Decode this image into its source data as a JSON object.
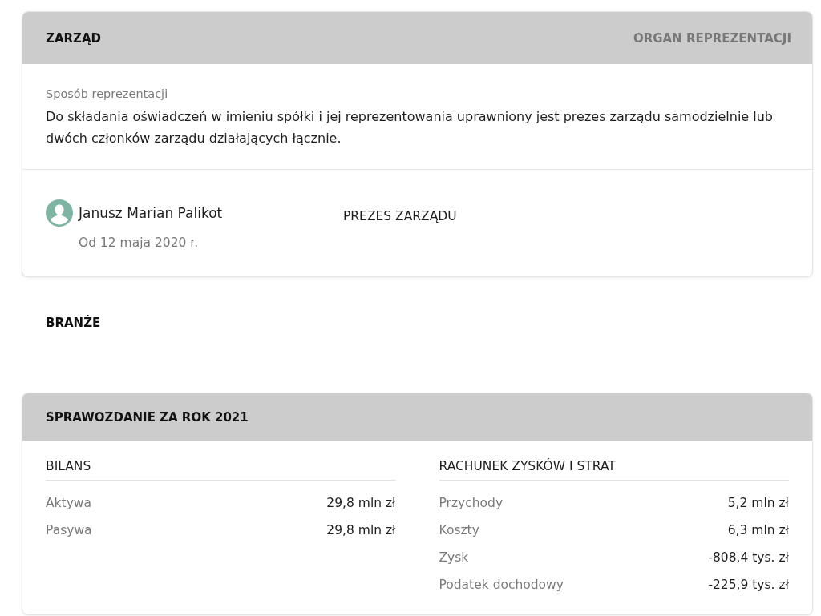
{
  "board": {
    "title": "ZARZĄD",
    "subtitle": "ORGAN REPREZENTACJI",
    "representation": {
      "label": "Sposób reprezentacji",
      "text": "Do składania oświadczeń w imieniu spółki i jej reprezentowania uprawniony jest prezes zarządu samodzielnie lub dwóch członków zarządu działających łącznie."
    },
    "members": [
      {
        "name": "Janusz Marian Palikot",
        "since": "Od 12 maja 2020 r.",
        "role": "PREZES ZARZĄDU"
      }
    ]
  },
  "industries": {
    "title": "BRANŻE"
  },
  "report": {
    "title": "SPRAWOZDANIE ZA ROK 2021",
    "sections": [
      {
        "title": "BILANS",
        "rows": [
          {
            "label": "Aktywa",
            "value": "29,8 mln zł"
          },
          {
            "label": "Pasywa",
            "value": "29,8 mln zł"
          }
        ]
      },
      {
        "title": "RACHUNEK ZYSKÓW I STRAT",
        "rows": [
          {
            "label": "Przychody",
            "value": "5,2 mln zł"
          },
          {
            "label": "Koszty",
            "value": "6,3 mln zł"
          },
          {
            "label": "Zysk",
            "value": "-808,4 tys. zł"
          },
          {
            "label": "Podatek dochodowy",
            "value": "-225,9 tys. zł"
          }
        ]
      }
    ]
  }
}
